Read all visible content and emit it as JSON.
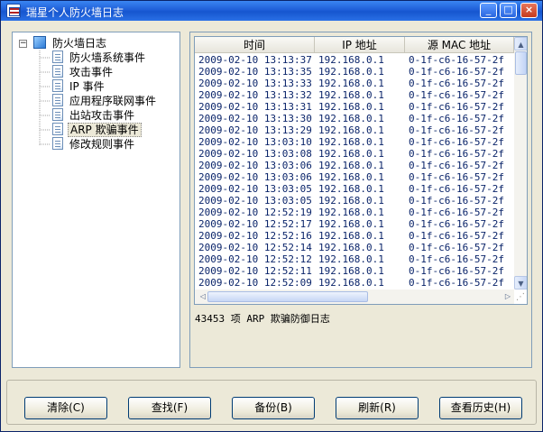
{
  "window": {
    "title": "瑞星个人防火墙日志",
    "min_label": "_",
    "max_label": "□",
    "close_label": "×"
  },
  "tree": {
    "expander": "−",
    "root_label": "防火墙日志",
    "items": [
      {
        "label": "防火墙系统事件"
      },
      {
        "label": "攻击事件"
      },
      {
        "label": "IP 事件"
      },
      {
        "label": "应用程序联网事件"
      },
      {
        "label": "出站攻击事件"
      },
      {
        "label": "ARP 欺骗事件",
        "selected": true
      },
      {
        "label": "修改规则事件"
      }
    ]
  },
  "log": {
    "columns": [
      "时间",
      "IP 地址",
      "源 MAC 地址"
    ],
    "rows": [
      [
        "2009-02-10 13:13:37",
        "192.168.0.1",
        "0-1f-c6-16-57-2f"
      ],
      [
        "2009-02-10 13:13:35",
        "192.168.0.1",
        "0-1f-c6-16-57-2f"
      ],
      [
        "2009-02-10 13:13:33",
        "192.168.0.1",
        "0-1f-c6-16-57-2f"
      ],
      [
        "2009-02-10 13:13:32",
        "192.168.0.1",
        "0-1f-c6-16-57-2f"
      ],
      [
        "2009-02-10 13:13:31",
        "192.168.0.1",
        "0-1f-c6-16-57-2f"
      ],
      [
        "2009-02-10 13:13:30",
        "192.168.0.1",
        "0-1f-c6-16-57-2f"
      ],
      [
        "2009-02-10 13:13:29",
        "192.168.0.1",
        "0-1f-c6-16-57-2f"
      ],
      [
        "2009-02-10 13:03:10",
        "192.168.0.1",
        "0-1f-c6-16-57-2f"
      ],
      [
        "2009-02-10 13:03:08",
        "192.168.0.1",
        "0-1f-c6-16-57-2f"
      ],
      [
        "2009-02-10 13:03:06",
        "192.168.0.1",
        "0-1f-c6-16-57-2f"
      ],
      [
        "2009-02-10 13:03:06",
        "192.168.0.1",
        "0-1f-c6-16-57-2f"
      ],
      [
        "2009-02-10 13:03:05",
        "192.168.0.1",
        "0-1f-c6-16-57-2f"
      ],
      [
        "2009-02-10 13:03:05",
        "192.168.0.1",
        "0-1f-c6-16-57-2f"
      ],
      [
        "2009-02-10 12:52:19",
        "192.168.0.1",
        "0-1f-c6-16-57-2f"
      ],
      [
        "2009-02-10 12:52:17",
        "192.168.0.1",
        "0-1f-c6-16-57-2f"
      ],
      [
        "2009-02-10 12:52:16",
        "192.168.0.1",
        "0-1f-c6-16-57-2f"
      ],
      [
        "2009-02-10 12:52:14",
        "192.168.0.1",
        "0-1f-c6-16-57-2f"
      ],
      [
        "2009-02-10 12:52:12",
        "192.168.0.1",
        "0-1f-c6-16-57-2f"
      ],
      [
        "2009-02-10 12:52:11",
        "192.168.0.1",
        "0-1f-c6-16-57-2f"
      ],
      [
        "2009-02-10 12:52:09",
        "192.168.0.1",
        "0-1f-c6-16-57-2f"
      ]
    ],
    "summary": "43453 项 ARP 欺骗防御日志"
  },
  "buttons": {
    "clear": "清除(C)",
    "find": "查找(F)",
    "backup": "备份(B)",
    "refresh": "刷新(R)",
    "history": "查看历史(H)"
  },
  "colors": {
    "title_bar": "#1f5fd8",
    "row_text": "#0a246a",
    "window_bg": "#ece9d8"
  }
}
